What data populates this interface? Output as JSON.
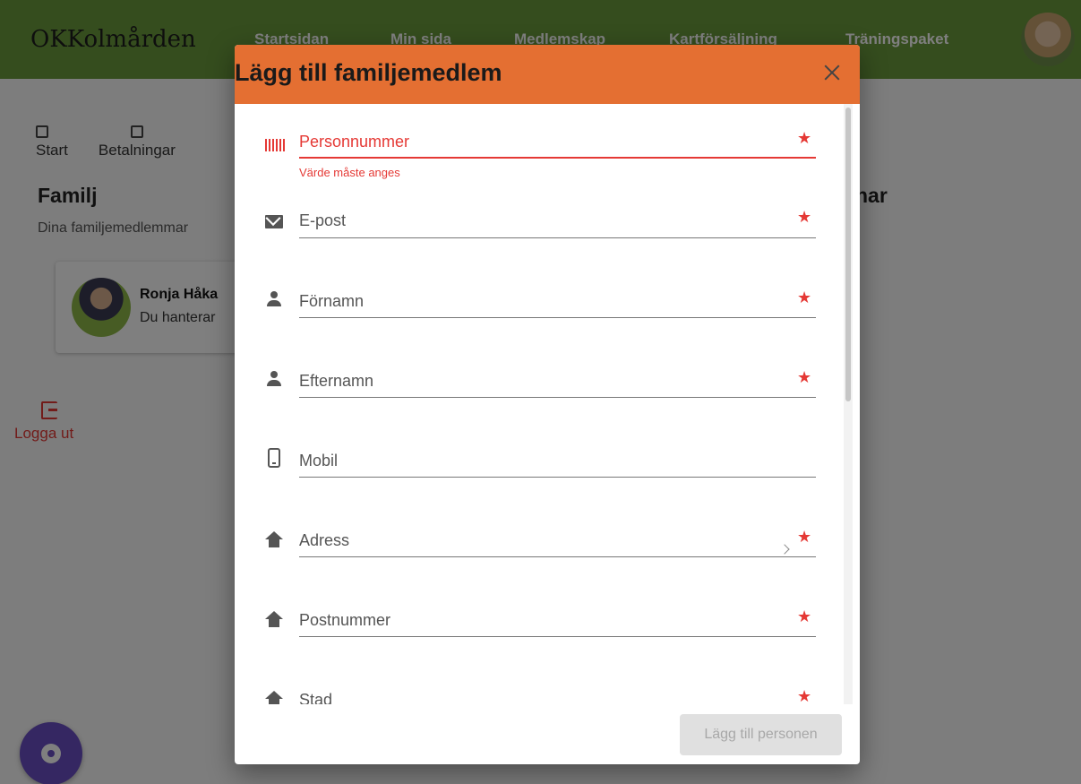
{
  "brand": {
    "logo_text": "OKKolmården"
  },
  "nav": {
    "items": [
      "Startsidan",
      "Min sida",
      "Medlemskap",
      "Kartförsäljning",
      "Träningspaket"
    ]
  },
  "tabs": [
    {
      "label": "Start",
      "icon": "calendar-icon"
    },
    {
      "label": "Betalningar",
      "icon": "wallet-icon"
    }
  ],
  "family": {
    "title": "Familj",
    "subtitle": "Dina familjemedlemmar",
    "right_title_partial": "nar",
    "member": {
      "name": "Ronja Håka",
      "description": "Du hanterar"
    }
  },
  "logout": {
    "label": "Logga ut",
    "icon": "logout-icon"
  },
  "fab": {
    "icon": "gear-icon"
  },
  "dialog": {
    "title": "Lägg till familjemedlem",
    "close_icon": "close-icon",
    "fields": [
      {
        "label": "Personnummer",
        "icon": "barcode-icon",
        "required": true,
        "error": "Värde måste anges"
      },
      {
        "label": "E-post",
        "icon": "mail-icon",
        "required": true
      },
      {
        "label": "Förnamn",
        "icon": "person-icon",
        "required": true
      },
      {
        "label": "Efternamn",
        "icon": "person-icon",
        "required": true
      },
      {
        "label": "Mobil",
        "icon": "phone-icon",
        "required": false
      },
      {
        "label": "Adress",
        "icon": "home-icon",
        "required": true
      },
      {
        "label": "Postnummer",
        "icon": "home-icon",
        "required": true
      },
      {
        "label": "Stad",
        "icon": "home-icon",
        "required": true
      }
    ],
    "submit_label": "Lägg till personen",
    "required_marker": "★"
  },
  "colors": {
    "topbar": "#6b9b3c",
    "dialog_header": "#e46f32",
    "error": "#e53935",
    "fab": "#6a4fc4"
  }
}
